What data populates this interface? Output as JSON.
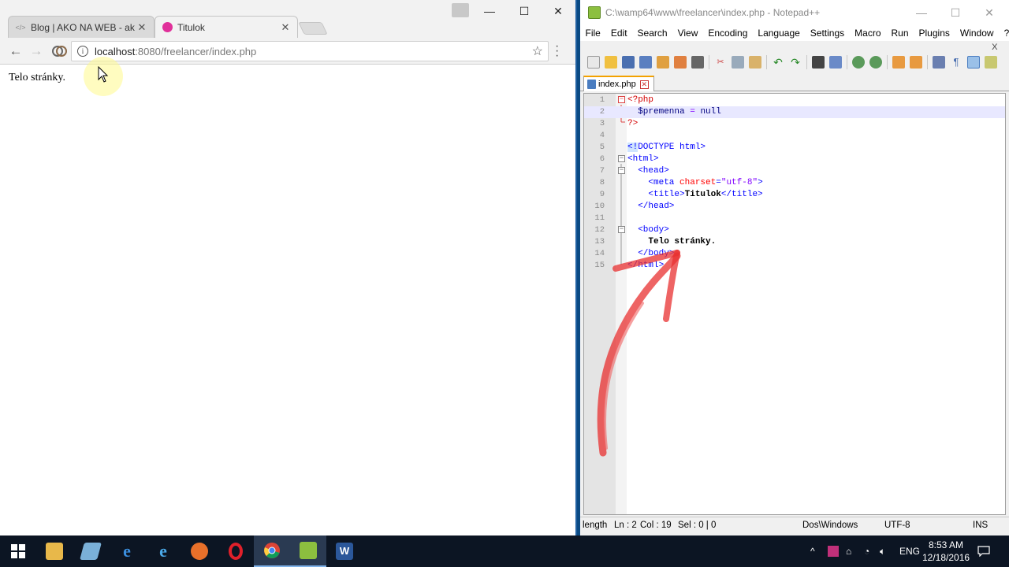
{
  "chrome": {
    "tabs": [
      {
        "label": "Blog | AKO NA WEB - ak",
        "favicon": "code-brackets-icon"
      },
      {
        "label": "Titulok",
        "favicon": "pink-circle-icon"
      }
    ],
    "url_host": "localhost",
    "url_rest": ":8080/freelancer/index.php",
    "page_text": "Telo stránky."
  },
  "notepad": {
    "title": "C:\\wamp64\\www\\freelancer\\index.php - Notepad++",
    "menu": [
      "File",
      "Edit",
      "Search",
      "View",
      "Encoding",
      "Language",
      "Settings",
      "Macro",
      "Run",
      "Plugins",
      "Window",
      "?"
    ],
    "close_doc": "X",
    "tab_label": "index.php",
    "lines": {
      "l1": "<?php",
      "l2a": "$premenna",
      "l2b": " = ",
      "l2c": "null",
      "l3": "?>",
      "l5a": "<!",
      "l5b": "DOCTYPE html>",
      "l6": "<html>",
      "l7": "<head>",
      "l8a": "<meta ",
      "l8b": "charset",
      "l8c": "=",
      "l8d": "\"utf-8\"",
      "l8e": ">",
      "l9a": "<title>",
      "l9b": "Titulok",
      "l9c": "</title>",
      "l10": "</head>",
      "l12": "<body>",
      "l13": "Telo stránky.",
      "l14": "</body>",
      "l15": "</html>"
    },
    "line_numbers": [
      "1",
      "2",
      "3",
      "4",
      "5",
      "6",
      "7",
      "8",
      "9",
      "10",
      "11",
      "12",
      "13",
      "14",
      "15"
    ],
    "status": {
      "length": "length",
      "ln": "Ln : 2",
      "col": "Col : 19",
      "sel": "Sel : 0 | 0",
      "eol": "Dos\\Windows",
      "encoding": "UTF-8",
      "mode": "INS"
    }
  },
  "taskbar": {
    "language": "ENG",
    "time": "8:53 AM",
    "date": "12/18/2016"
  },
  "colors": {
    "php_delimiter": "#d40000",
    "html_tag": "#0000ff",
    "attribute": "#ff0000",
    "annotation_arrow": "#e83030"
  }
}
